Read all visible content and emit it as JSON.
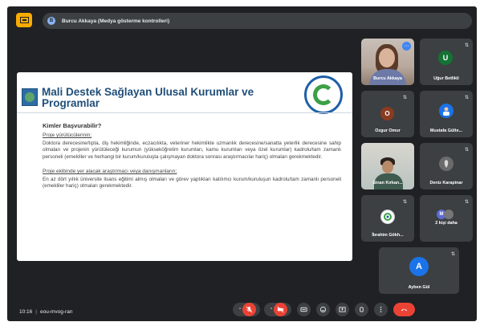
{
  "presenter": {
    "chip_icon": "presentation-icon",
    "avatar_letter": "B",
    "banner_text": "Burcu Akkaya (Medya gösterme kontrolleri)"
  },
  "slide": {
    "title": "Mali Destek Sağlayan Ulusal Kurumlar ve Programlar",
    "section_heading": "Kimler Başvurabilir?",
    "subheading1": "Proje yürütücülerinin;",
    "paragraph1": "Doktora derecesine/tıpta, diş hekimliğinde, eczacılıkta, veteriner hekimlikte uzmanlık derecesine/sanatta yeterlik derecesine sahip olmaları ve projenin yürütüleceği kurumun (yükseköğretim kurumları, kamu kurumları veya özel kurumlar) kadrolu/tam zamanlı personeli (emekliler ve herhangi bir kurum/kuruluşta çalışmayan doktora sonrası araştırmacılar hariç) olmaları gerekmektedir.",
    "subheading2": "Proje ekibinde yer alacak araştırmacı veya danışmanların;",
    "paragraph2": "En az dört yıllık üniversite lisans eğitimi almış olmaları ve görev yaptıkları katılımcı kurum/kuruluşun kadrolu/tam zamanlı personeli (emekliler hariç) olmaları gerekmektedir.",
    "seal_text": "GİRESUN ÜNİVERSİTESİ 2006"
  },
  "participants": [
    {
      "name": "Burcu Akkaya",
      "type": "video"
    },
    {
      "name": "Uğur Betlikli",
      "avatar_letter": "U",
      "avatar_color": "#137333"
    },
    {
      "name": "Ozgur Omur",
      "avatar_letter": "O",
      "avatar_color": "#8a3b20"
    },
    {
      "name": "Mustafa Gülte...",
      "avatar_letter": "",
      "avatar_color": "#1a73e8"
    },
    {
      "name": "Sinan Kırkan...",
      "type": "video"
    },
    {
      "name": "Deniz Karapinar",
      "avatar_letter": "",
      "avatar_color": "#4a4a4a"
    },
    {
      "name": "İbrahim Gökh...",
      "avatar_letter": "",
      "avatar_color": "#ffffff"
    },
    {
      "name": "2 kişi daha",
      "avatar_letter": "M",
      "avatar_color": "#5e6ad2"
    },
    {
      "name": "Ayben Gül",
      "avatar_letter": "A",
      "avatar_color": "#1a73e8"
    }
  ],
  "meeting": {
    "time": "10:16",
    "code": "eou-mvog-ran"
  },
  "colors": {
    "background": "#202124",
    "tile": "#3c4043",
    "danger": "#ea4335",
    "accent": "#f9ab00"
  }
}
